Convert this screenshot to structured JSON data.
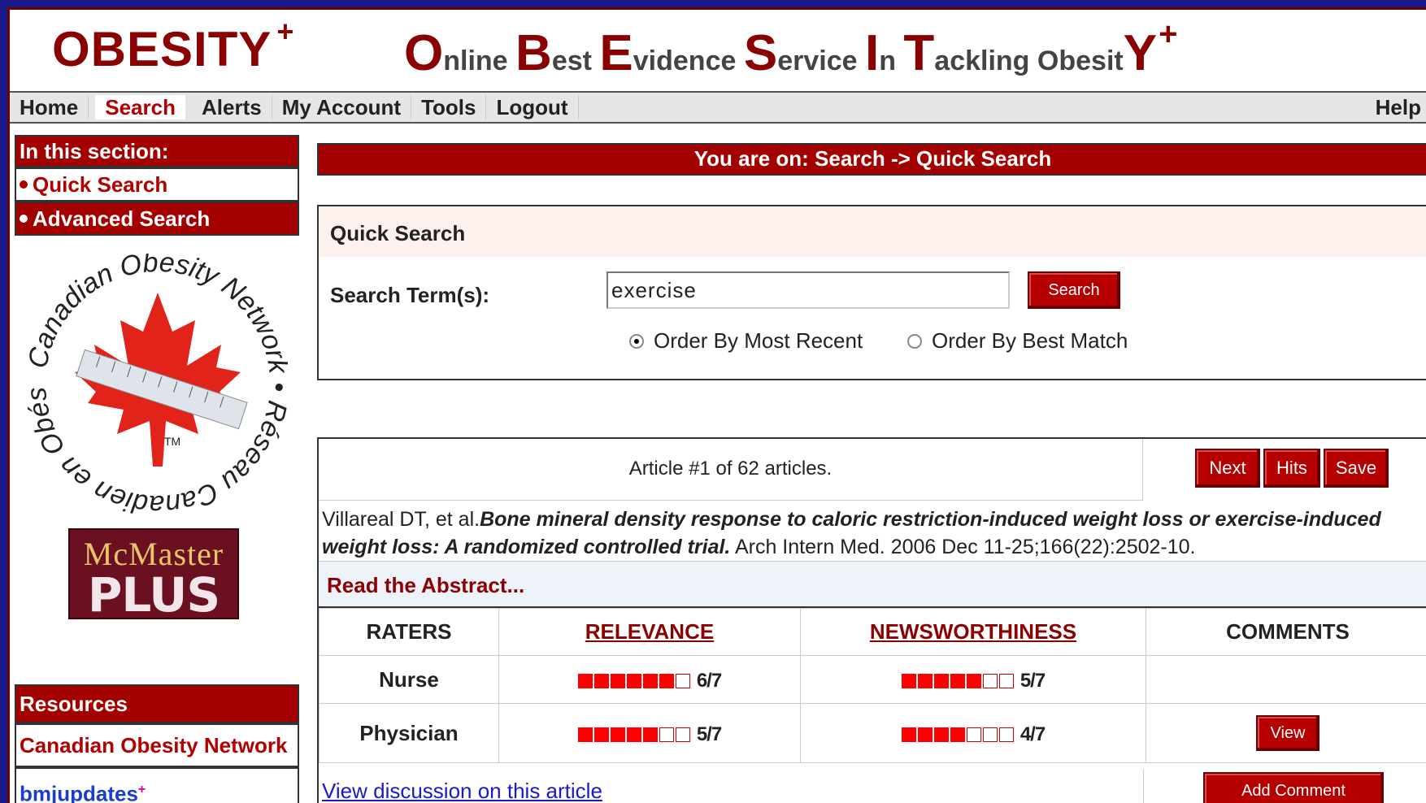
{
  "header": {
    "brand": "OBESITY",
    "brand_sup": "+",
    "tagline": [
      {
        "cap": "O",
        "rest": "nline "
      },
      {
        "cap": "B",
        "rest": "est "
      },
      {
        "cap": "E",
        "rest": "vidence "
      },
      {
        "cap": "S",
        "rest": "ervice "
      },
      {
        "cap": "I",
        "rest": "n "
      },
      {
        "cap": "T",
        "rest": "ackling "
      },
      {
        "cap": "",
        "rest": "Obesit"
      },
      {
        "cap": "Y",
        "rest": ""
      }
    ],
    "tagline_sup": "+"
  },
  "nav": {
    "home": "Home",
    "search": "Search",
    "alerts": "Alerts",
    "my_account": "My Account",
    "tools": "Tools",
    "logout": "Logout",
    "help": "Help"
  },
  "sidebar": {
    "section_title": "In this section:",
    "quick_search": "Quick Search",
    "advanced_search": "Advanced Search",
    "network_logo_text": "Canadian Obesity Network • Réseau Canadien en Obésité",
    "network_logo_tm": "TM",
    "mcmaster_top": "McMaster",
    "mcmaster_bottom": "PLUS",
    "resources_title": "Resources",
    "resource_can": "Canadian Obesity Network",
    "resource_bmj": "bmjupdates",
    "resource_bmj_sup": "+"
  },
  "breadcrumb": "You are on: Search -> Quick Search",
  "quick_search": {
    "title": "Quick Search",
    "label": "Search Term(s):",
    "value": "exercise",
    "button": "Search",
    "order_recent": "Order By Most Recent",
    "order_best": "Order By Best Match",
    "selected": "recent"
  },
  "article": {
    "count_text": "Article #1 of 62 articles.",
    "next": "Next",
    "hits": "Hits",
    "save": "Save",
    "authors": "Villareal DT, et al.",
    "title": "Bone mineral density response to caloric restriction-induced weight loss or exercise-induced weight loss: A randomized controlled trial.",
    "journal": " Arch Intern Med. 2006 Dec 11-25;166(22):2502-10.",
    "abstract_link": "Read the Abstract...",
    "discussion_link": "View discussion on this article",
    "add_comment": "Add Comment"
  },
  "ratings": {
    "headers": {
      "raters": "RATERS",
      "relevance": "RELEVANCE",
      "newsworthiness": "NEWSWORTHINESS",
      "comments": "COMMENTS"
    },
    "rows": [
      {
        "rater": "Nurse",
        "relevance": 6,
        "relevance_text": "6/7",
        "news": 5,
        "news_text": "5/7",
        "comment": ""
      },
      {
        "rater": "Physician",
        "relevance": 5,
        "relevance_text": "5/7",
        "news": 4,
        "news_text": "4/7",
        "comment": "View"
      }
    ],
    "max": 7
  },
  "colors": {
    "brand_red": "#8b0000",
    "button_red": "#b60000",
    "rating_red": "#ff0000",
    "frame_blue": "#1a1a8c"
  }
}
